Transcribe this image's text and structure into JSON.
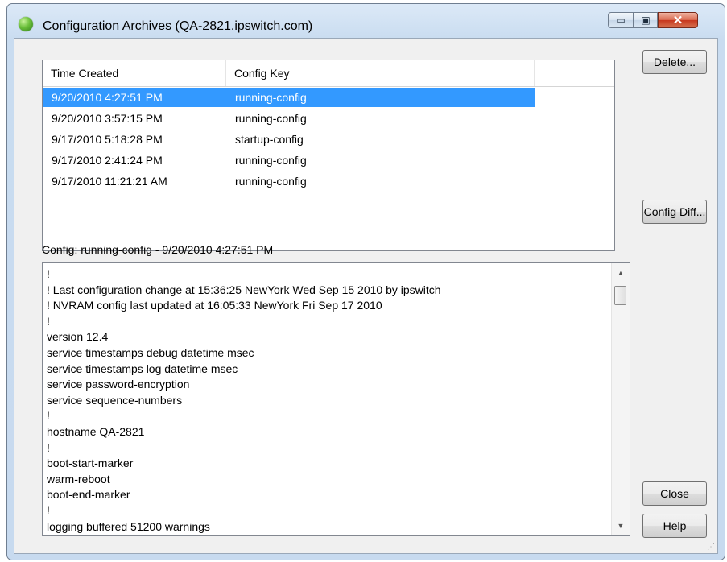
{
  "window": {
    "title": "Configuration Archives (QA-2821.ipswitch.com)",
    "caption_buttons": {
      "minimize": "▭",
      "maximize": "▣",
      "close": "✕"
    }
  },
  "archives": {
    "columns": [
      "Time Created",
      "Config Key"
    ],
    "rows": [
      {
        "time": "9/20/2010 4:27:51 PM",
        "key": "running-config",
        "selected": true
      },
      {
        "time": "9/20/2010 3:57:15 PM",
        "key": "running-config"
      },
      {
        "time": "9/17/2010 5:18:28 PM",
        "key": "startup-config"
      },
      {
        "time": "9/17/2010 2:41:24 PM",
        "key": "running-config"
      },
      {
        "time": "9/17/2010 11:21:21 AM",
        "key": "running-config"
      }
    ]
  },
  "buttons": {
    "delete": "Delete...",
    "config_diff": "Config Diff...",
    "close": "Close",
    "help": "Help"
  },
  "config": {
    "label": "Config: running-config - 9/20/2010 4:27:51 PM",
    "lines": [
      "!",
      "! Last configuration change at 15:36:25 NewYork Wed Sep 15 2010 by ipswitch",
      "! NVRAM config last updated at 16:05:33 NewYork Fri Sep 17 2010",
      "!",
      "version 12.4",
      "service timestamps debug datetime msec",
      "service timestamps log datetime msec",
      "service password-encryption",
      "service sequence-numbers",
      "!",
      "hostname QA-2821",
      "!",
      "boot-start-marker",
      "warm-reboot",
      "boot-end-marker",
      "!",
      "logging buffered 51200 warnings"
    ]
  },
  "scrollbar": {
    "up": "▲",
    "down": "▼"
  },
  "colors": {
    "selection": "#3399ff",
    "titlebar": "#dce9f7",
    "close_button": "#c7381e"
  }
}
